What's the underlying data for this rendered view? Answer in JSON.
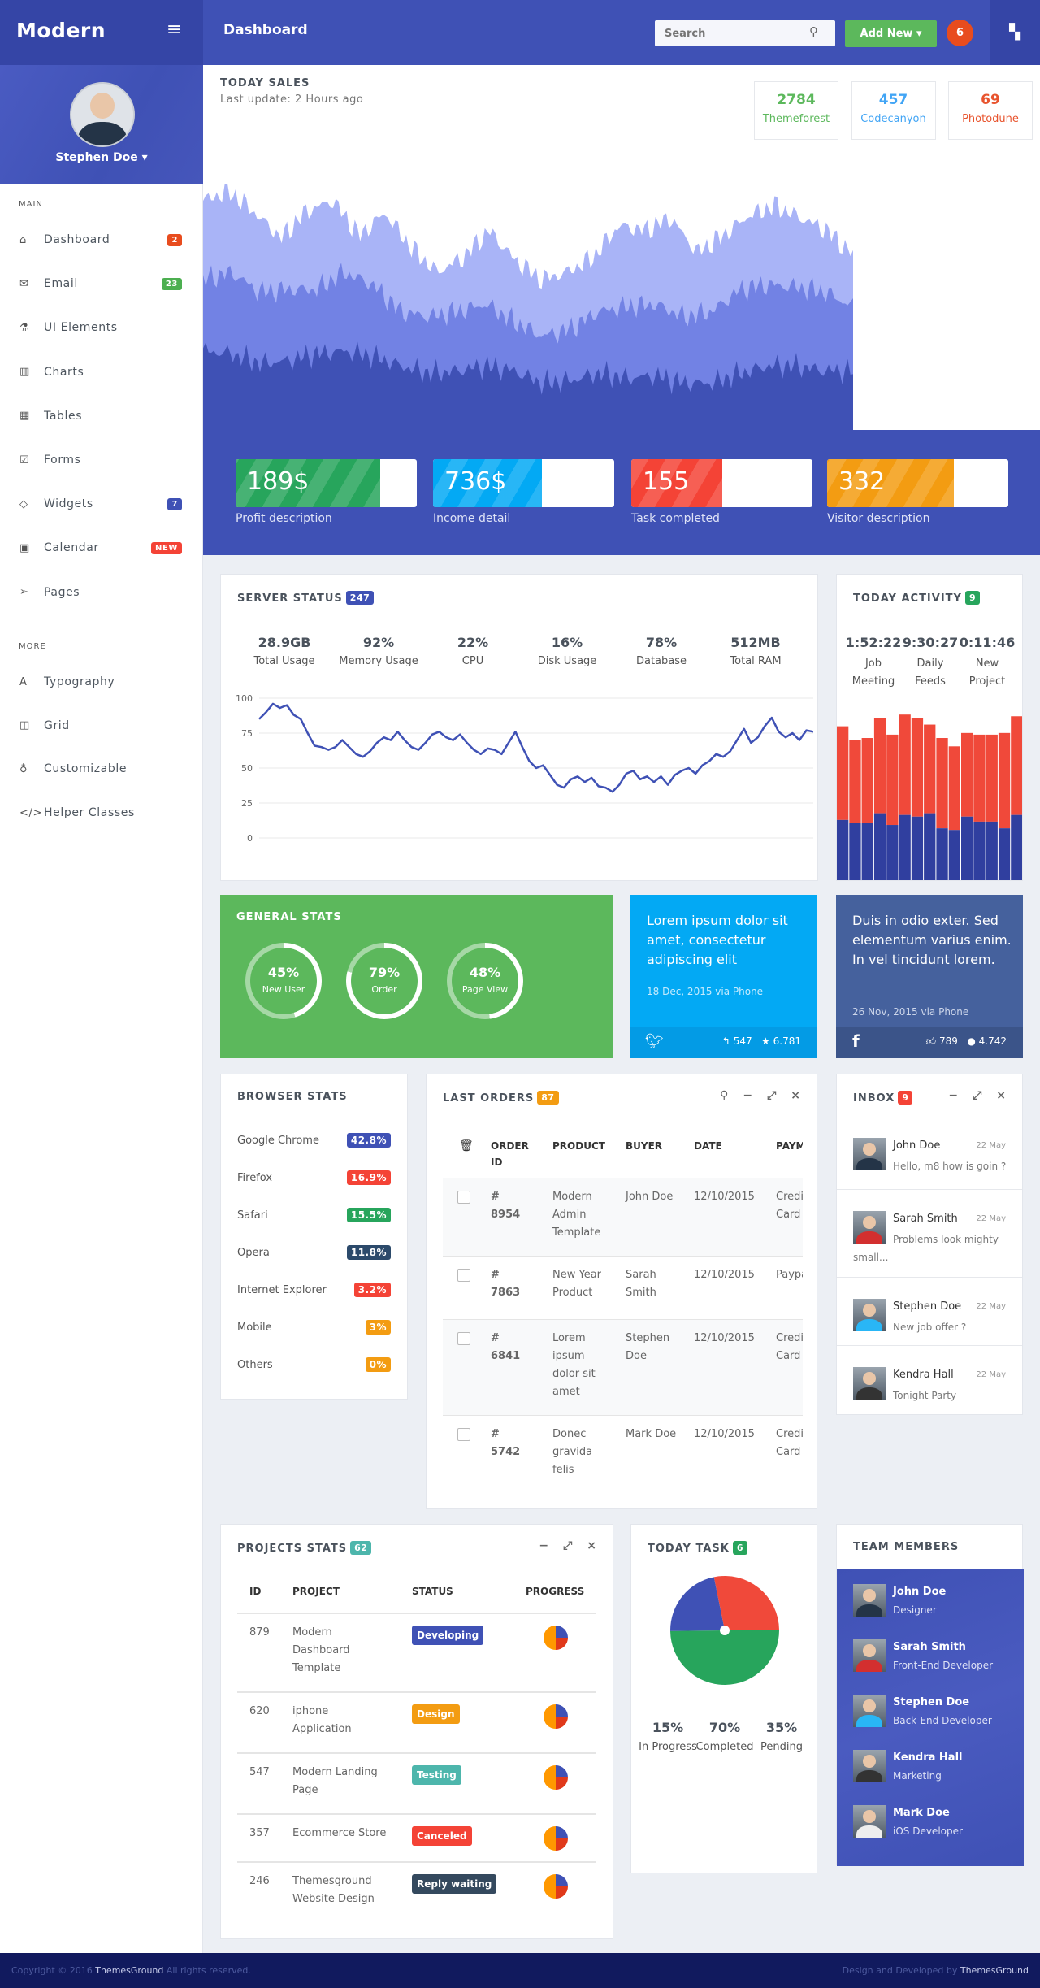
{
  "header": {
    "logo": "Modern",
    "title": "Dashboard",
    "search_placeholder": "Search",
    "add_new": "Add New ▾",
    "notifications": "6",
    "menu_icon": "hamburger-icon",
    "apps_icon": "grid-icon"
  },
  "sidebar": {
    "user_name": "Stephen Doe ▾",
    "main_label": "MAIN",
    "more_label": "MORE",
    "main_items": [
      {
        "label": "Dashboard",
        "icon": "home-icon",
        "glyph": "⌂",
        "badge": "2",
        "badge_color": "#e84c1e"
      },
      {
        "label": "Email",
        "icon": "envelope-icon",
        "glyph": "✉",
        "badge": "23",
        "badge_color": "#4caf50"
      },
      {
        "label": "UI Elements",
        "icon": "flask-icon",
        "glyph": "⚗"
      },
      {
        "label": "Charts",
        "icon": "bar-chart-icon",
        "glyph": "▥"
      },
      {
        "label": "Tables",
        "icon": "table-icon",
        "glyph": "▦"
      },
      {
        "label": "Forms",
        "icon": "checkbox-icon",
        "glyph": "☑"
      },
      {
        "label": "Widgets",
        "icon": "diamond-icon",
        "glyph": "◇",
        "badge": "7",
        "badge_color": "#3f51b5"
      },
      {
        "label": "Calendar",
        "icon": "calendar-icon",
        "glyph": "▣",
        "badge": "NEW",
        "badge_color": "#f44336"
      },
      {
        "label": "Pages",
        "icon": "paper-plane-icon",
        "glyph": "➢"
      }
    ],
    "more_items": [
      {
        "label": "Typography",
        "icon": "font-icon",
        "glyph": "A"
      },
      {
        "label": "Grid",
        "icon": "columns-icon",
        "glyph": "◫"
      },
      {
        "label": "Customizable",
        "icon": "lightbulb-icon",
        "glyph": "♁"
      },
      {
        "label": "Helper Classes",
        "icon": "code-icon",
        "glyph": "</>"
      }
    ]
  },
  "today_sales": {
    "title": "TODAY SALES",
    "subtitle": "Last update: 2 Hours ago",
    "stats": [
      {
        "value": "2784",
        "label": "Themeforest",
        "color": "#5cb85c"
      },
      {
        "value": "457",
        "label": "Codecanyon",
        "color": "#42a5f5"
      },
      {
        "value": "69",
        "label": "Photodune",
        "color": "#e8542e"
      }
    ],
    "area_chart": {
      "colors": [
        "#a9b4f7",
        "#7282e4",
        "#3f51b5"
      ],
      "layers": [
        [
          93,
          97,
          88,
          78,
          89,
          93,
          79,
          88,
          74,
          64,
          70,
          81,
          69,
          61,
          64,
          70,
          83,
          81,
          86,
          72,
          79,
          87,
          91,
          86,
          81,
          71
        ],
        [
          61,
          64,
          56,
          57,
          57,
          64,
          59,
          48,
          46,
          48,
          51,
          44,
          38,
          41,
          48,
          50,
          51,
          46,
          48,
          57,
          59,
          58,
          56,
          50
        ],
        [
          32,
          31,
          27,
          28,
          31,
          32,
          30,
          26,
          23,
          24,
          26,
          24,
          19,
          20,
          23,
          21,
          22,
          19,
          19,
          23,
          26,
          26,
          24,
          24
        ]
      ]
    },
    "progress": [
      {
        "value": "189$",
        "label": "Profit description",
        "percent": 80,
        "color": "#27a55c"
      },
      {
        "value": "736$",
        "label": "Income detail",
        "percent": 60,
        "color": "#03a9f4"
      },
      {
        "value": "155",
        "label": "Task completed",
        "percent": 50,
        "color": "#f44336"
      },
      {
        "value": "332",
        "label": "Visitor description",
        "percent": 70,
        "color": "#f39c12"
      }
    ]
  },
  "server_status": {
    "title": "SERVER STATUS",
    "badge": "247",
    "stats": [
      {
        "value": "28.9GB",
        "label": "Total Usage"
      },
      {
        "value": "92%",
        "label": "Memory Usage"
      },
      {
        "value": "22%",
        "label": "CPU"
      },
      {
        "value": "16%",
        "label": "Disk Usage"
      },
      {
        "value": "78%",
        "label": "Database"
      },
      {
        "value": "512MB",
        "label": "Total RAM"
      }
    ],
    "chart_data": {
      "type": "line",
      "yticks": [
        "100",
        "75",
        "50",
        "25",
        "0"
      ],
      "ylim": [
        0,
        100
      ],
      "grid": true,
      "color": "#3f51b5",
      "values": [
        85,
        90,
        96,
        93,
        95,
        88,
        85,
        75,
        66,
        65,
        63,
        65,
        70,
        65,
        60,
        58,
        62,
        68,
        72,
        70,
        76,
        70,
        65,
        63,
        68,
        74,
        76,
        72,
        70,
        74,
        68,
        63,
        60,
        64,
        63,
        60,
        68,
        76,
        65,
        55,
        50,
        52,
        45,
        38,
        36,
        42,
        44,
        40,
        43,
        37,
        36,
        33,
        38,
        46,
        48,
        42,
        44,
        40,
        44,
        38,
        45,
        48,
        50,
        46,
        52,
        55,
        60,
        58,
        62,
        70,
        78,
        68,
        72,
        80,
        86,
        76,
        72,
        75,
        70,
        77,
        76
      ]
    }
  },
  "today_activity": {
    "title": "TODAY ACTIVITY",
    "badge": "9",
    "stats": [
      {
        "value": "1:52:22",
        "label": "Job Meeting"
      },
      {
        "value": "9:30:27",
        "label": "Daily Feeds"
      },
      {
        "value": "0:11:46",
        "label": "New Project"
      }
    ],
    "chart_data": {
      "type": "bar",
      "stacked": true,
      "colors": [
        "#303f9f",
        "#f0493a"
      ],
      "series": [
        {
          "values": [
            37,
            35,
            35,
            41,
            34,
            40,
            39,
            41,
            32,
            31,
            39,
            36,
            36,
            32,
            40,
            36
          ]
        },
        {
          "values": [
            56,
            50,
            51,
            57,
            54,
            60,
            59,
            53,
            54,
            50,
            50,
            52,
            52,
            57,
            59,
            54
          ]
        }
      ]
    }
  },
  "general_stats": {
    "title": "GENERAL STATS",
    "rings": [
      {
        "value": "45%",
        "label": "New User",
        "percent": 45
      },
      {
        "value": "79%",
        "label": "Order",
        "percent": 79
      },
      {
        "value": "48%",
        "label": "Page View",
        "percent": 48
      }
    ]
  },
  "twitter": {
    "text": "Lorem ipsum dolor sit amet, consectetur adipiscing elit",
    "meta": "18 Dec, 2015 via Phone",
    "replies": "547",
    "favorites": "6.781"
  },
  "facebook": {
    "text": "Duis in odio exter. Sed elementum varius enim. In vel tincidunt lorem.",
    "meta": "26 Nov, 2015 via Phone",
    "likes": "789",
    "comments": "4.742"
  },
  "browser_stats": {
    "title": "BROWSER STATS",
    "items": [
      {
        "name": "Google Chrome",
        "value": "42.8%",
        "color": "#3f51b5"
      },
      {
        "name": "Firefox",
        "value": "16.9%",
        "color": "#f44336"
      },
      {
        "name": "Safari",
        "value": "15.5%",
        "color": "#27a55c"
      },
      {
        "name": "Opera",
        "value": "11.8%",
        "color": "#2c4a6b"
      },
      {
        "name": "Internet Explorer",
        "value": "3.2%",
        "color": "#f44336"
      },
      {
        "name": "Mobile",
        "value": "3%",
        "color": "#f39c12"
      },
      {
        "name": "Others",
        "value": "0%",
        "color": "#f39c12"
      }
    ]
  },
  "last_orders": {
    "title": "LAST ORDERS",
    "badge": "87",
    "columns": [
      "ORDER ID",
      "PRODUCT",
      "BUYER",
      "DATE",
      "PAYMENT"
    ],
    "rows": [
      {
        "id": "# 8954",
        "product": "Modern Admin Template",
        "buyer": "John Doe",
        "date": "12/10/2015",
        "payment": "Credit Card"
      },
      {
        "id": "# 7863",
        "product": "New Year Product",
        "buyer": "Sarah Smith",
        "date": "12/10/2015",
        "payment": "Paypal"
      },
      {
        "id": "# 6841",
        "product": "Lorem ipsum dolor sit amet",
        "buyer": "Stephen Doe",
        "date": "12/10/2015",
        "payment": "Credit Card"
      },
      {
        "id": "# 5742",
        "product": "Donec gravida felis",
        "buyer": "Mark Doe",
        "date": "12/10/2015",
        "payment": "Credit Card"
      }
    ]
  },
  "inbox": {
    "title": "INBOX",
    "badge": "9",
    "messages": [
      {
        "name": "John Doe",
        "date": "22 May",
        "text": "Hello, m8 how is goin ?"
      },
      {
        "name": "Sarah Smith",
        "date": "22 May",
        "text": "Problems look mighty small..."
      },
      {
        "name": "Stephen Doe",
        "date": "22 May",
        "text": "New job offer ?"
      },
      {
        "name": "Kendra Hall",
        "date": "22 May",
        "text": "Tonight Party"
      }
    ]
  },
  "projects": {
    "title": "PROJECTS STATS",
    "badge": "62",
    "columns": [
      "ID",
      "PROJECT",
      "STATUS",
      "PROGRESS"
    ],
    "rows": [
      {
        "id": "879",
        "project": "Modern Dashboard Template",
        "status": "Developing",
        "color": "#3f51b5"
      },
      {
        "id": "620",
        "project": "iphone Application",
        "status": "Design",
        "color": "#f39c12"
      },
      {
        "id": "547",
        "project": "Modern Landing Page",
        "status": "Testing",
        "color": "#4db6ac"
      },
      {
        "id": "357",
        "project": "Ecommerce Store",
        "status": "Canceled",
        "color": "#f44336"
      },
      {
        "id": "246",
        "project": "Themesground Website Design",
        "status": "Reply waiting",
        "color": "#34495e"
      }
    ]
  },
  "today_task": {
    "title": "TODAY TASK",
    "badge": "6",
    "stats": [
      {
        "value": "15%",
        "label": "In Progress"
      },
      {
        "value": "70%",
        "label": "Completed"
      },
      {
        "value": "35%",
        "label": "Pending"
      }
    ],
    "chart_data": {
      "type": "pie",
      "slices": [
        {
          "value": 28,
          "color": "#f0493a"
        },
        {
          "value": 50,
          "color": "#27a55c"
        },
        {
          "value": 22,
          "color": "#3f51b5"
        }
      ]
    }
  },
  "team": {
    "title": "TEAM MEMBERS",
    "members": [
      {
        "name": "John Doe",
        "role": "Designer"
      },
      {
        "name": "Sarah Smith",
        "role": "Front-End Developer"
      },
      {
        "name": "Stephen Doe",
        "role": "Back-End Developer"
      },
      {
        "name": "Kendra Hall",
        "role": "Marketing"
      },
      {
        "name": "Mark Doe",
        "role": "iOS Developer"
      }
    ]
  },
  "footer": {
    "left_prefix": "Copyright © 2016 ",
    "left_brand": "ThemesGround",
    "left_suffix": " All rights reserved.",
    "right_prefix": "Design and Developed by ",
    "right_brand": "ThemesGround"
  }
}
